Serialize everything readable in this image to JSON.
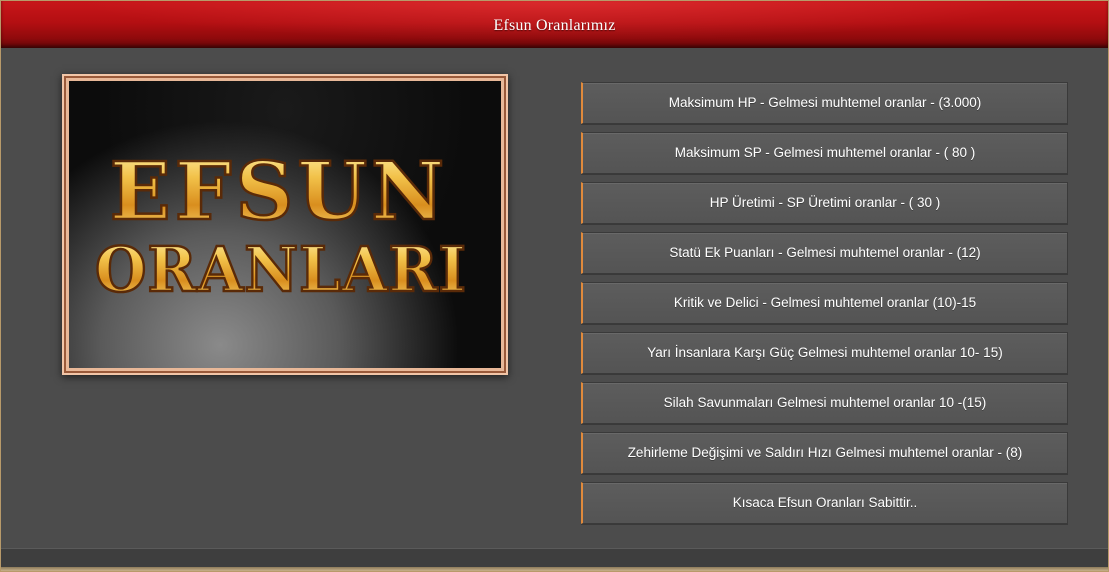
{
  "header": {
    "title": "Efsun Oranlarımız"
  },
  "banner": {
    "line1": "EFSUN",
    "line2": "ORANLARI"
  },
  "menu": {
    "items": [
      {
        "label": "Maksimum HP - Gelmesi muhtemel oranlar - (3.000)"
      },
      {
        "label": "Maksimum SP - Gelmesi muhtemel oranlar - ( 80 )"
      },
      {
        "label": "HP Üretimi - SP Üretimi oranlar - ( 30 )"
      },
      {
        "label": "Statü Ek Puanları - Gelmesi muhtemel oranlar - (12)"
      },
      {
        "label": "Kritik ve Delici - Gelmesi muhtemel oranlar (10)-15"
      },
      {
        "label": "Yarı İnsanlara Karşı Güç Gelmesi muhtemel oranlar 10- 15)"
      },
      {
        "label": "Silah Savunmaları Gelmesi muhtemel oranlar 10 -(15)"
      },
      {
        "label": "Zehirleme Değişimi ve Saldırı Hızı Gelmesi muhtemel oranlar - (8)"
      },
      {
        "label": "Kısaca Efsun Oranları Sabittir.."
      }
    ]
  },
  "colors": {
    "header_red": "#b40f12",
    "background": "#4c4c4c",
    "button_bg": "#585858",
    "button_accent": "#e08a3c",
    "banner_frame": "#f2c6a8",
    "banner_text_gold": "#e8b840"
  }
}
